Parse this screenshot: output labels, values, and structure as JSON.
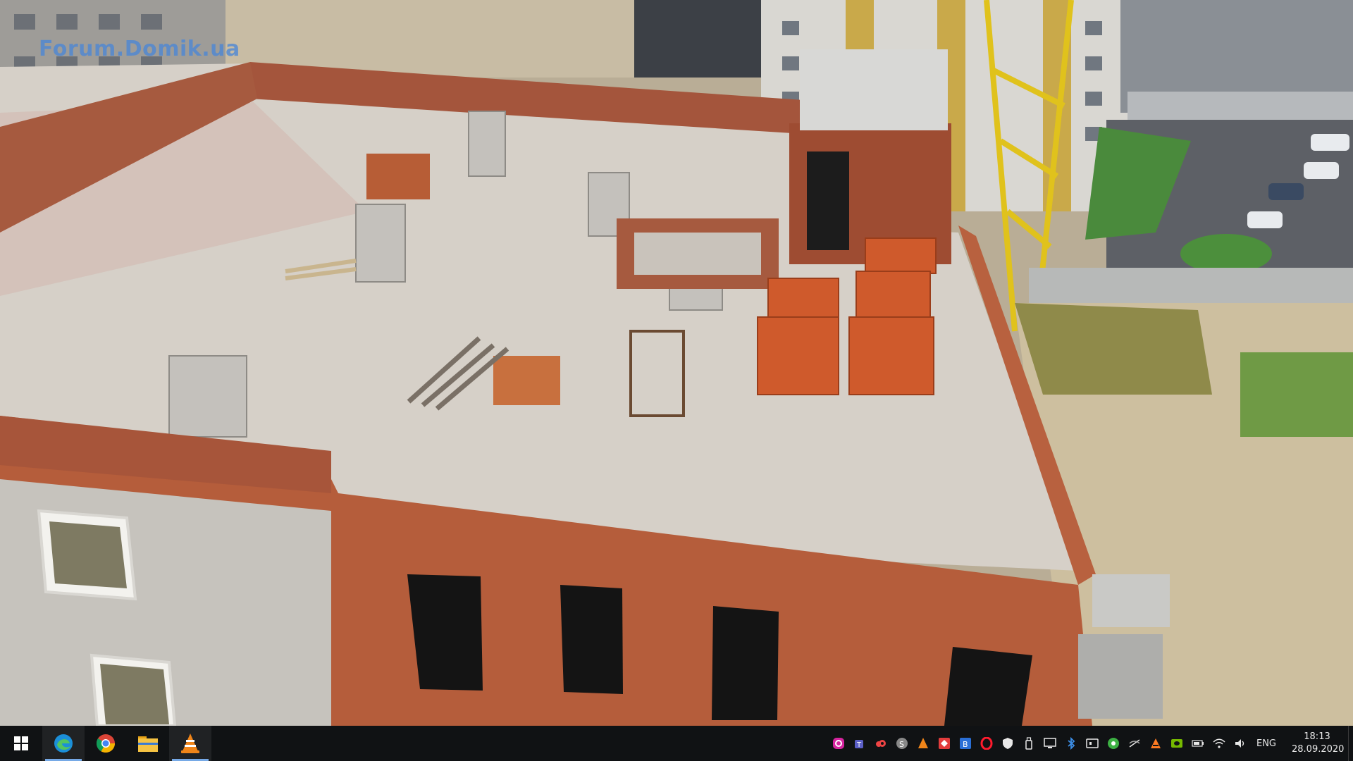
{
  "wallpaper": {
    "watermark": "Forum.Domik.ua",
    "description_icon": "construction-rooftop-photo"
  },
  "taskbar": {
    "start_icon": "windows-start-icon",
    "pinned": [
      {
        "name": "edge",
        "icon": "edge-icon",
        "active": true
      },
      {
        "name": "chrome",
        "icon": "chrome-icon",
        "active": false
      },
      {
        "name": "file-explorer",
        "icon": "folder-icon",
        "active": false
      },
      {
        "name": "vlc",
        "icon": "vlc-icon",
        "active": true
      }
    ],
    "tray_icons": [
      "instagram-icon",
      "teams-icon",
      "cloud-app-icon",
      "skype-icon",
      "vlc-tray-icon",
      "anydesk-icon",
      "bitdefender-icon",
      "opera-icon",
      "security-shield-icon",
      "usb-drive-icon",
      "display-icon",
      "bluetooth-icon",
      "media-icon",
      "green-app-icon",
      "network-off-icon",
      "orange-app-icon",
      "nvidia-icon",
      "battery-icon",
      "wifi-icon",
      "volume-icon"
    ],
    "language": "ENG",
    "time": "18:13",
    "date": "28.09.2020"
  },
  "colors": {
    "taskbar_bg": "#101214",
    "accent": "#76a9e6"
  }
}
